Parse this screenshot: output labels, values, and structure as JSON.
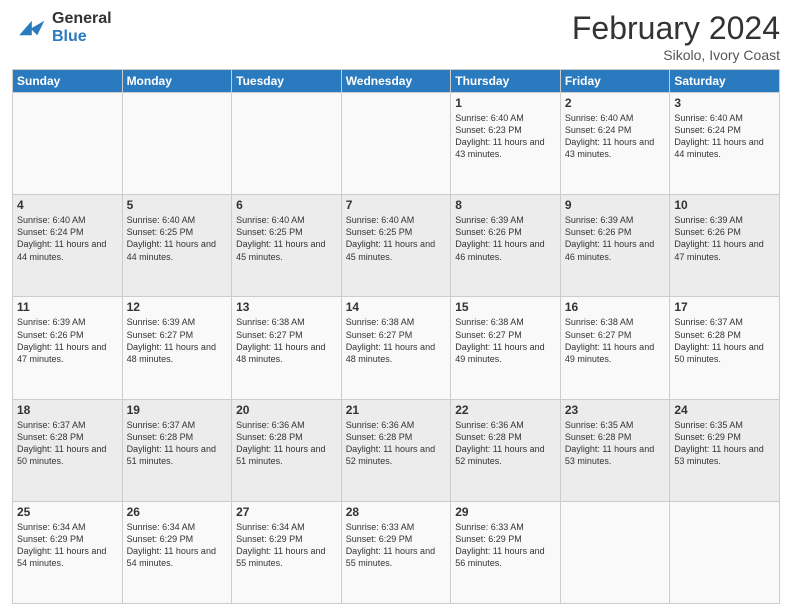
{
  "logo": {
    "general": "General",
    "blue": "Blue"
  },
  "header": {
    "month": "February 2024",
    "location": "Sikolo, Ivory Coast"
  },
  "columns": [
    "Sunday",
    "Monday",
    "Tuesday",
    "Wednesday",
    "Thursday",
    "Friday",
    "Saturday"
  ],
  "weeks": [
    [
      {
        "day": "",
        "info": ""
      },
      {
        "day": "",
        "info": ""
      },
      {
        "day": "",
        "info": ""
      },
      {
        "day": "",
        "info": ""
      },
      {
        "day": "1",
        "info": "Sunrise: 6:40 AM\nSunset: 6:23 PM\nDaylight: 11 hours\nand 43 minutes."
      },
      {
        "day": "2",
        "info": "Sunrise: 6:40 AM\nSunset: 6:24 PM\nDaylight: 11 hours\nand 43 minutes."
      },
      {
        "day": "3",
        "info": "Sunrise: 6:40 AM\nSunset: 6:24 PM\nDaylight: 11 hours\nand 44 minutes."
      }
    ],
    [
      {
        "day": "4",
        "info": "Sunrise: 6:40 AM\nSunset: 6:24 PM\nDaylight: 11 hours\nand 44 minutes."
      },
      {
        "day": "5",
        "info": "Sunrise: 6:40 AM\nSunset: 6:25 PM\nDaylight: 11 hours\nand 44 minutes."
      },
      {
        "day": "6",
        "info": "Sunrise: 6:40 AM\nSunset: 6:25 PM\nDaylight: 11 hours\nand 45 minutes."
      },
      {
        "day": "7",
        "info": "Sunrise: 6:40 AM\nSunset: 6:25 PM\nDaylight: 11 hours\nand 45 minutes."
      },
      {
        "day": "8",
        "info": "Sunrise: 6:39 AM\nSunset: 6:26 PM\nDaylight: 11 hours\nand 46 minutes."
      },
      {
        "day": "9",
        "info": "Sunrise: 6:39 AM\nSunset: 6:26 PM\nDaylight: 11 hours\nand 46 minutes."
      },
      {
        "day": "10",
        "info": "Sunrise: 6:39 AM\nSunset: 6:26 PM\nDaylight: 11 hours\nand 47 minutes."
      }
    ],
    [
      {
        "day": "11",
        "info": "Sunrise: 6:39 AM\nSunset: 6:26 PM\nDaylight: 11 hours\nand 47 minutes."
      },
      {
        "day": "12",
        "info": "Sunrise: 6:39 AM\nSunset: 6:27 PM\nDaylight: 11 hours\nand 48 minutes."
      },
      {
        "day": "13",
        "info": "Sunrise: 6:38 AM\nSunset: 6:27 PM\nDaylight: 11 hours\nand 48 minutes."
      },
      {
        "day": "14",
        "info": "Sunrise: 6:38 AM\nSunset: 6:27 PM\nDaylight: 11 hours\nand 48 minutes."
      },
      {
        "day": "15",
        "info": "Sunrise: 6:38 AM\nSunset: 6:27 PM\nDaylight: 11 hours\nand 49 minutes."
      },
      {
        "day": "16",
        "info": "Sunrise: 6:38 AM\nSunset: 6:27 PM\nDaylight: 11 hours\nand 49 minutes."
      },
      {
        "day": "17",
        "info": "Sunrise: 6:37 AM\nSunset: 6:28 PM\nDaylight: 11 hours\nand 50 minutes."
      }
    ],
    [
      {
        "day": "18",
        "info": "Sunrise: 6:37 AM\nSunset: 6:28 PM\nDaylight: 11 hours\nand 50 minutes."
      },
      {
        "day": "19",
        "info": "Sunrise: 6:37 AM\nSunset: 6:28 PM\nDaylight: 11 hours\nand 51 minutes."
      },
      {
        "day": "20",
        "info": "Sunrise: 6:36 AM\nSunset: 6:28 PM\nDaylight: 11 hours\nand 51 minutes."
      },
      {
        "day": "21",
        "info": "Sunrise: 6:36 AM\nSunset: 6:28 PM\nDaylight: 11 hours\nand 52 minutes."
      },
      {
        "day": "22",
        "info": "Sunrise: 6:36 AM\nSunset: 6:28 PM\nDaylight: 11 hours\nand 52 minutes."
      },
      {
        "day": "23",
        "info": "Sunrise: 6:35 AM\nSunset: 6:28 PM\nDaylight: 11 hours\nand 53 minutes."
      },
      {
        "day": "24",
        "info": "Sunrise: 6:35 AM\nSunset: 6:29 PM\nDaylight: 11 hours\nand 53 minutes."
      }
    ],
    [
      {
        "day": "25",
        "info": "Sunrise: 6:34 AM\nSunset: 6:29 PM\nDaylight: 11 hours\nand 54 minutes."
      },
      {
        "day": "26",
        "info": "Sunrise: 6:34 AM\nSunset: 6:29 PM\nDaylight: 11 hours\nand 54 minutes."
      },
      {
        "day": "27",
        "info": "Sunrise: 6:34 AM\nSunset: 6:29 PM\nDaylight: 11 hours\nand 55 minutes."
      },
      {
        "day": "28",
        "info": "Sunrise: 6:33 AM\nSunset: 6:29 PM\nDaylight: 11 hours\nand 55 minutes."
      },
      {
        "day": "29",
        "info": "Sunrise: 6:33 AM\nSunset: 6:29 PM\nDaylight: 11 hours\nand 56 minutes."
      },
      {
        "day": "",
        "info": ""
      },
      {
        "day": "",
        "info": ""
      }
    ]
  ]
}
